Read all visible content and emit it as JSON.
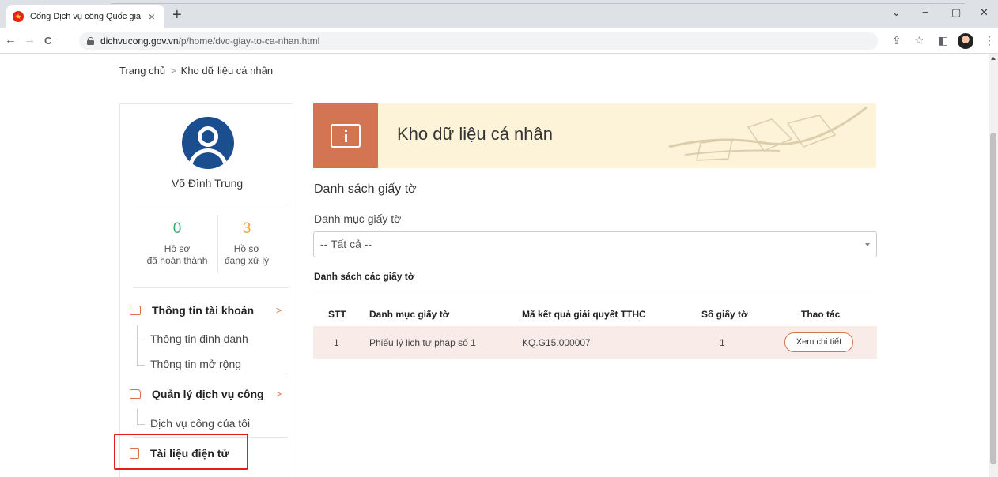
{
  "browser": {
    "tab_title": "Cổng Dịch vụ công Quốc gia",
    "tab_close": "×",
    "new_tab": "+",
    "url_host": "dichvucong.gov.vn",
    "url_path": "/p/home/dvc-giay-to-ca-nhan.html",
    "nav": {
      "back": "←",
      "forward": "→",
      "reload": "C"
    },
    "window": {
      "collapse": "⌄",
      "minimize": "−",
      "restore": "▢",
      "close": "✕"
    },
    "toolbar_icons": {
      "share": "⇪",
      "star": "☆",
      "sidepanel": "◧",
      "menu": "⋮"
    }
  },
  "breadcrumb": {
    "home": "Trang chủ",
    "separator": ">",
    "current": "Kho dữ liệu cá nhân"
  },
  "sidebar": {
    "user_name": "Võ Đình Trung",
    "stats": [
      {
        "value": "0",
        "label_line1": "Hồ sơ",
        "label_line2": "đã hoàn thành",
        "color": "#2fae6f"
      },
      {
        "value": "3",
        "label_line1": "Hồ sơ",
        "label_line2": "đang xử lý",
        "color": "#f0a22e"
      }
    ],
    "menu": {
      "account": {
        "label": "Thông tin tài khoản",
        "chevron": ">",
        "items": [
          "Thông tin định danh",
          "Thông tin mở rộng"
        ]
      },
      "services": {
        "label": "Quản lý dịch vụ công",
        "chevron": ">",
        "items": [
          "Dịch vụ công của tôi"
        ]
      },
      "documents": {
        "label": "Tài liệu điện tử"
      }
    }
  },
  "main": {
    "banner_title": "Kho dữ liệu cá nhân",
    "section_title": "Danh sách giấy tờ",
    "category_label": "Danh mục giấy tờ",
    "category_selected": "-- Tất cả --",
    "list_title": "Danh sách các giấy tờ",
    "table": {
      "headers": [
        "STT",
        "Danh mục giấy tờ",
        "Mã kết quả giải quyết TTHC",
        "Số giấy tờ",
        "Thao tác"
      ],
      "rows": [
        {
          "stt": "1",
          "category": "Phiếu lý lịch tư pháp số 1",
          "code": "KQ.G15.000007",
          "count": "1",
          "action": "Xem chi tiết"
        }
      ]
    }
  },
  "colors": {
    "accent": "#d37552",
    "banner_bg": "#fdf3d9",
    "row_bg": "#f9ece8",
    "highlight": "#e02020",
    "avatar": "#1b4e8f"
  }
}
